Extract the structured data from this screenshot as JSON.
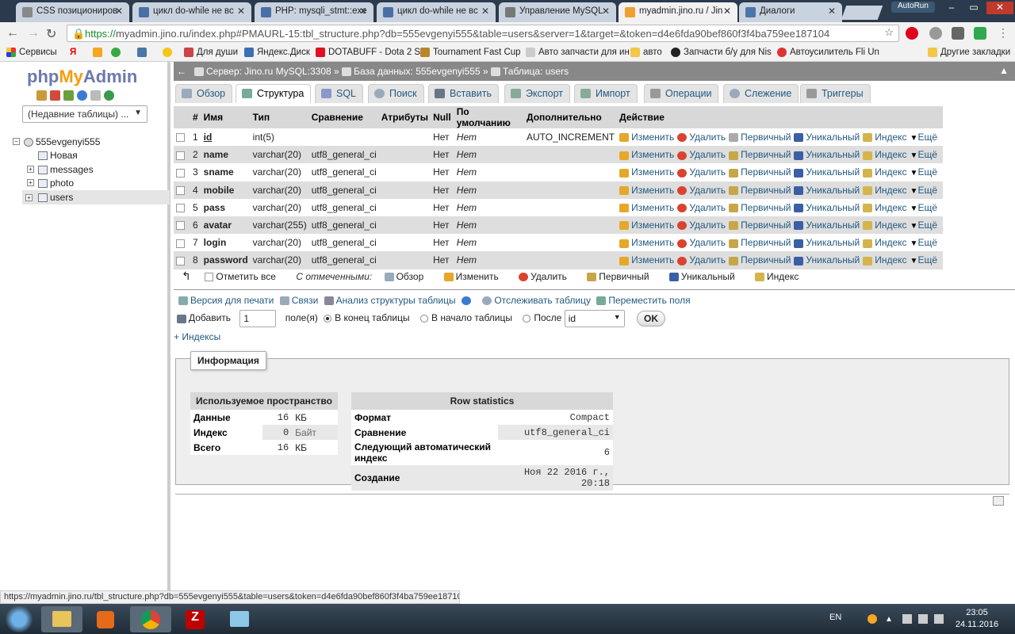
{
  "browser": {
    "tabs": [
      {
        "title": "CSS позициониров"
      },
      {
        "title": "цикл do-while не вс"
      },
      {
        "title": "PHP: mysqli_stmt::exe"
      },
      {
        "title": "цикл do-while не вс"
      },
      {
        "title": "Управление MySQL"
      },
      {
        "title": "myadmin.jino.ru / Jin",
        "active": true
      },
      {
        "title": "Диалоги"
      }
    ],
    "autorun_label": "AutoRun",
    "url_https": "https://",
    "url_rest": "myadmin.jino.ru/index.php#PMAURL-15:tbl_structure.php?db=555evgenyi555&table=users&server=1&target=&token=d4e6fda90bef860f3f4ba759ee187104",
    "bookmarks": [
      {
        "label": "Сервисы"
      },
      {
        "label": "Я"
      },
      {
        "label": ""
      },
      {
        "label": ""
      },
      {
        "label": ""
      },
      {
        "label": ""
      },
      {
        "label": "Для души"
      },
      {
        "label": "Яндекс.Диск"
      },
      {
        "label": "DOTABUFF - Dota 2 S"
      },
      {
        "label": "Tournament Fast Cup"
      },
      {
        "label": "Авто запчасти для ин"
      },
      {
        "label": "авто"
      },
      {
        "label": "Запчасти б/у для Nis"
      },
      {
        "label": "Автоусилитель Fli Un"
      },
      {
        "label": "Другие закладки"
      }
    ]
  },
  "sidebar": {
    "logo_php": "php",
    "logo_my": "My",
    "logo_admin": "Admin",
    "recent_tables": "(Недавние таблицы) ...",
    "db_name": "555evgenyi555",
    "items": [
      {
        "label": "Новая"
      },
      {
        "label": "messages"
      },
      {
        "label": "photo"
      },
      {
        "label": "users"
      }
    ]
  },
  "breadcrumb": {
    "server": "Сервер: Jino.ru MySQL:3308",
    "database": "База данных: 555evgenyi555",
    "table": "Таблица: users",
    "sep": "»"
  },
  "menu_tabs": [
    {
      "label": "Обзор"
    },
    {
      "label": "Структура",
      "active": true
    },
    {
      "label": "SQL"
    },
    {
      "label": "Поиск"
    },
    {
      "label": "Вставить"
    },
    {
      "label": "Экспорт"
    },
    {
      "label": "Импорт"
    },
    {
      "label": "Операции"
    },
    {
      "label": "Слежение"
    },
    {
      "label": "Триггеры"
    }
  ],
  "structure": {
    "headers": [
      "#",
      "Имя",
      "Тип",
      "Сравнение",
      "Атрибуты",
      "Null",
      "По умолчанию",
      "Дополнительно",
      "Действие"
    ],
    "actions": {
      "edit": "Изменить",
      "delete": "Удалить",
      "primary": "Первичный",
      "unique": "Уникальный",
      "index": "Индекс",
      "more": "Ещё"
    },
    "rows": [
      {
        "num": "1",
        "name": "id",
        "type": "int(5)",
        "collation": "",
        "null": "Нет",
        "default": "Нет",
        "extra": "AUTO_INCREMENT"
      },
      {
        "num": "2",
        "name": "name",
        "type": "varchar(20)",
        "collation": "utf8_general_ci",
        "null": "Нет",
        "default": "Нет",
        "extra": ""
      },
      {
        "num": "3",
        "name": "sname",
        "type": "varchar(20)",
        "collation": "utf8_general_ci",
        "null": "Нет",
        "default": "Нет",
        "extra": ""
      },
      {
        "num": "4",
        "name": "mobile",
        "type": "varchar(20)",
        "collation": "utf8_general_ci",
        "null": "Нет",
        "default": "Нет",
        "extra": ""
      },
      {
        "num": "5",
        "name": "pass",
        "type": "varchar(20)",
        "collation": "utf8_general_ci",
        "null": "Нет",
        "default": "Нет",
        "extra": ""
      },
      {
        "num": "6",
        "name": "avatar",
        "type": "varchar(255)",
        "collation": "utf8_general_ci",
        "null": "Нет",
        "default": "Нет",
        "extra": ""
      },
      {
        "num": "7",
        "name": "login",
        "type": "varchar(20)",
        "collation": "utf8_general_ci",
        "null": "Нет",
        "default": "Нет",
        "extra": ""
      },
      {
        "num": "8",
        "name": "password",
        "type": "varchar(20)",
        "collation": "utf8_general_ci",
        "null": "Нет",
        "default": "Нет",
        "extra": ""
      }
    ]
  },
  "bulk": {
    "check_all": "Отметить все",
    "with_selected": "С отмеченными:",
    "browse": "Обзор",
    "edit": "Изменить",
    "delete": "Удалить",
    "primary": "Первичный",
    "unique": "Уникальный",
    "index": "Индекс"
  },
  "links": {
    "print": "Версия для печати",
    "relations": "Связи",
    "analyze": "Анализ структуры таблицы",
    "track": "Отслеживать таблицу",
    "move": "Переместить поля"
  },
  "add_fields": {
    "add": "Добавить",
    "count": "1",
    "fields_label": "поле(я)",
    "at_end": "В конец таблицы",
    "at_start": "В начало таблицы",
    "after": "После",
    "after_field": "id",
    "ok": "OK"
  },
  "indexes_link": "+ Индексы",
  "info": {
    "legend": "Информация",
    "space_title": "Используемое пространство",
    "space": [
      {
        "label": "Данные",
        "value": "16",
        "unit": "КБ"
      },
      {
        "label": "Индекс",
        "value": "0",
        "unit": "Байт"
      },
      {
        "label": "Всего",
        "value": "16",
        "unit": "КБ"
      }
    ],
    "stats_title": "Row statistics",
    "stats": [
      {
        "label": "Формат",
        "value": "Compact"
      },
      {
        "label": "Сравнение",
        "value": "utf8_general_ci"
      },
      {
        "label": "Следующий автоматический индекс",
        "value": "6"
      },
      {
        "label": "Создание",
        "value": "Ноя 22 2016 г., 20:18"
      }
    ]
  },
  "status_bar": "https://myadmin.jino.ru/tbl_structure.php?db=555evgenyi555&table=users&token=d4e6fda90bef860f3f4ba759ee187104",
  "taskbar": {
    "lang": "EN",
    "time": "23:05",
    "date": "24.11.2016"
  }
}
